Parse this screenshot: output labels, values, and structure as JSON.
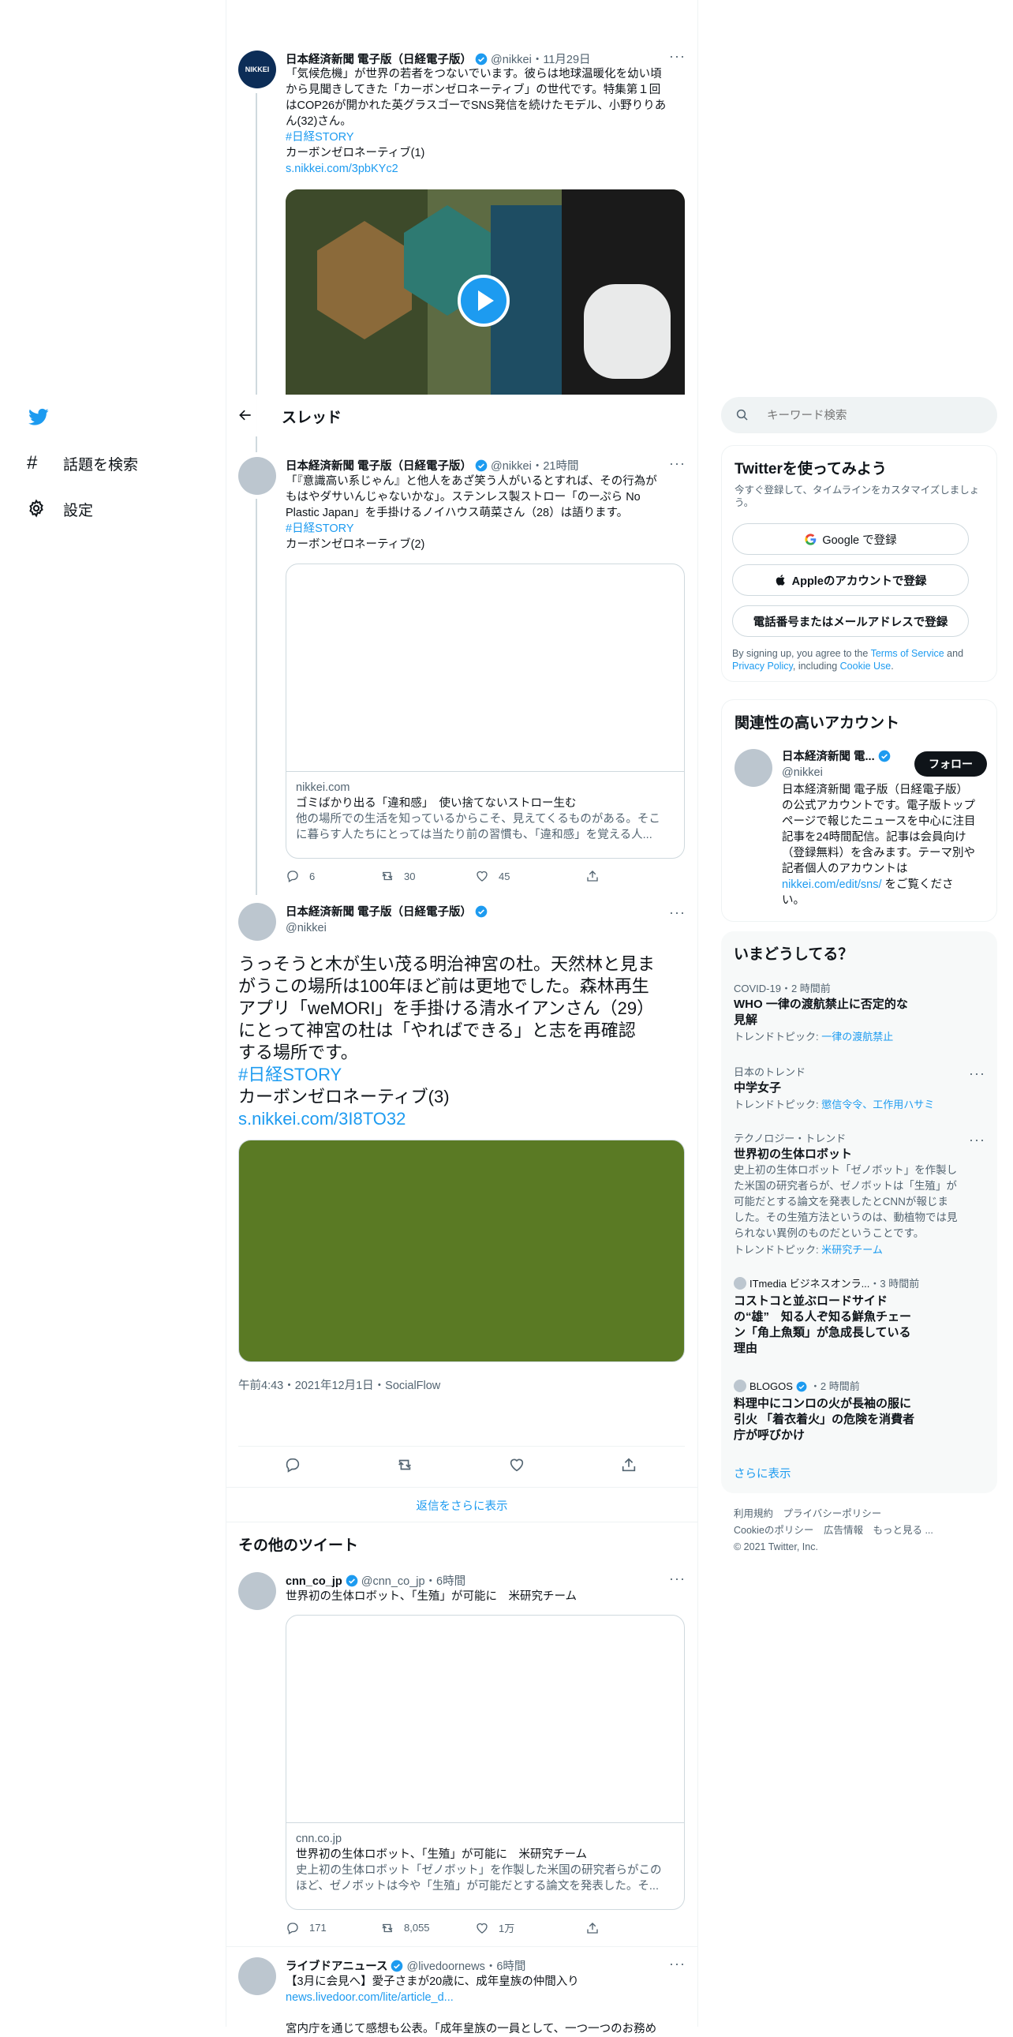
{
  "nav": {
    "explore": "話題を検索",
    "settings": "設定"
  },
  "header": {
    "title": "スレッド"
  },
  "tweet1": {
    "name": "日本経済新聞 電子版（日経電子版）",
    "handle": "@nikkei",
    "time": "11月29日",
    "avatar_text": "NIKKEI",
    "lines": [
      "「気候危機」が世界の若者をつないでいます。彼らは地球温暖化を幼い頃",
      "から見聞きしてきた「カーボンゼロネーティブ」の世代です。特集第１回",
      "はCOP26が開かれた英グラスゴーでSNS発信を続けたモデル、小野りりあ",
      "ん(32)さん。"
    ],
    "hashtag": "#日経STORY",
    "subtitle": "カーボンゼロネーティブ(1)",
    "url": "s.nikkei.com/3pbKYc2"
  },
  "tweet2": {
    "name": "日本経済新聞 電子版（日経電子版）",
    "handle": "@nikkei",
    "time": "21時間",
    "lines": [
      "「『意識高い系じゃん』と他人をあざ笑う人がいるとすれば、その行為が",
      "もはやダサいんじゃないかな」。ステンレス製ストロー「のーぷら No",
      "Plastic Japan」を手掛けるノイハウス萌菜さん（28）は語ります。"
    ],
    "hashtag": "#日経STORY",
    "subtitle": "カーボンゼロネーティブ(2)",
    "card": {
      "domain": "nikkei.com",
      "title": "ゴミばかり出る「違和感」　使い捨てないストロー生む",
      "desc1": "他の場所での生活を知っているからこそ、見えてくるものがある。そこ",
      "desc2": "に暮らす人たちにとっては当たり前の習慣も、「違和感」を覚える人..."
    },
    "stats": {
      "replies": "6",
      "retweets": "30",
      "likes": "45"
    }
  },
  "main": {
    "name": "日本経済新聞 電子版（日経電子版）",
    "handle": "@nikkei",
    "lines": [
      "うっそうと木が生い茂る明治神宮の杜。天然林と見ま",
      "がうこの場所は100年ほど前は更地でした。森林再生",
      "アプリ「weMORI」を手掛ける清水イアンさん（29）",
      "にとって神宮の杜は「やればできる」と志を再確認",
      "する場所です。"
    ],
    "hashtag": "#日経STORY",
    "subtitle": "カーボンゼロネーティブ(3)",
    "url": "s.nikkei.com/3I8TO32",
    "image_color": "#5a7a24",
    "timestamp": "午前4:43・2021年12月1日・SocialFlow"
  },
  "more_replies": "返信をさらに表示",
  "other_tweets": {
    "heading": "その他のツイート",
    "cnn": {
      "name": "cnn_co_jp",
      "handle": "@cnn_co_jp",
      "time": "6時間",
      "text": "世界初の生体ロボット、「生殖」が可能に　米研究チーム",
      "card": {
        "domain": "cnn.co.jp",
        "title": "世界初の生体ロボット、「生殖」が可能に　米研究チーム",
        "desc1": "史上初の生体ロボット「ゼノボット」を作製した米国の研究者らがこの",
        "desc2": "ほど、ゼノボットは今や「生殖」が可能だとする論文を発表した。そ..."
      },
      "stats": {
        "replies": "171",
        "retweets": "8,055",
        "likes": "1万"
      }
    },
    "livedoor": {
      "name": "ライブドアニュース",
      "handle": "@livedoornews",
      "time": "6時間",
      "text": "【3月に会見へ】愛子さまが20歳に、成年皇族の仲間入り",
      "url": "news.livedoor.com/lite/article_d...",
      "partial": "宮内庁を通じて感想も公表。「成年皇族の一員として、一つ一つのお務め"
    }
  },
  "search": {
    "placeholder": "キーワード検索"
  },
  "signup": {
    "title": "Twitterを使ってみよう",
    "subtitle": "今すぐ登録して、タイムラインをカスタマイズしましょう。",
    "google": "Google で登録",
    "apple": "Appleのアカウントで登録",
    "phone": "電話番号またはメールアドレスで登録",
    "terms_prefix": "By signing up, you agree to the ",
    "terms_link": "Terms of Service",
    "terms_and": " and ",
    "privacy_link": "Privacy Policy",
    "terms_incl": ", including ",
    "cookie_link": "Cookie Use",
    "terms_end": "."
  },
  "related": {
    "title": "関連性の高いアカウント",
    "name": "日本経済新聞 電...",
    "handle": "@nikkei",
    "follow": "フォロー",
    "bio_lines": [
      "日本経済新聞 電子版（日経電子版）",
      "の公式アカウントです。電子版トップ",
      "ページで報じたニュースを中心に注目",
      "記事を24時間配信。記事は会員向け",
      "（登録無料）を含みます。テーマ別や",
      "記者個人のアカウントは"
    ],
    "bio_link": "nikkei.com/edit/sns/",
    "bio_tail1": " をご覧くださ",
    "bio_tail2": "い。"
  },
  "trends": {
    "title": "いまどうしてる？",
    "items": [
      {
        "category": "COVID-19・2 時間前",
        "title1": "WHO 一律の渡航禁止に否定的な",
        "title2": "見解",
        "topic_prefix": "トレンドトピック: ",
        "topic": "一律の渡航禁止"
      },
      {
        "category": "日本のトレンド",
        "title1": "中学女子",
        "topic_prefix": "トレンドトピック: ",
        "topic": "懲信令令、工作用ハサミ"
      },
      {
        "category": "テクノロジー・トレンド",
        "title1": "世界初の生体ロボット",
        "desc": [
          "史上初の生体ロボット「ゼノボット」を作製し",
          "た米国の研究者らが、ゼノボットは「生殖」が",
          "可能だとする論文を発表したとCNNが報じま",
          "した。その生殖方法というのは、動植物では見",
          "られない異例のものだということです。"
        ],
        "topic_prefix": "トレンドトピック: ",
        "topic": "米研究チーム"
      },
      {
        "source": "ITmedia ビジネスオンラ...",
        "time": "・3 時間前",
        "lines": [
          "コストコと並ぶロードサイド",
          "の“雄”　知る人ぞ知る鮮魚チェー",
          "ン「角上魚類」が急成長している",
          "理由"
        ]
      },
      {
        "source": "BLOGOS",
        "time": "・2 時間前",
        "lines": [
          "料理中にコンロの火が長袖の服に",
          "引火 「着衣着火」の危険を消費者",
          "庁が呼びかけ"
        ]
      }
    ],
    "show_more": "さらに表示"
  },
  "footer": {
    "line1": [
      "利用規約",
      "プライバシーポリシー"
    ],
    "line2": [
      "Cookieのポリシー",
      "広告情報",
      "もっと見る ..."
    ],
    "copyright": "© 2021 Twitter, Inc."
  }
}
